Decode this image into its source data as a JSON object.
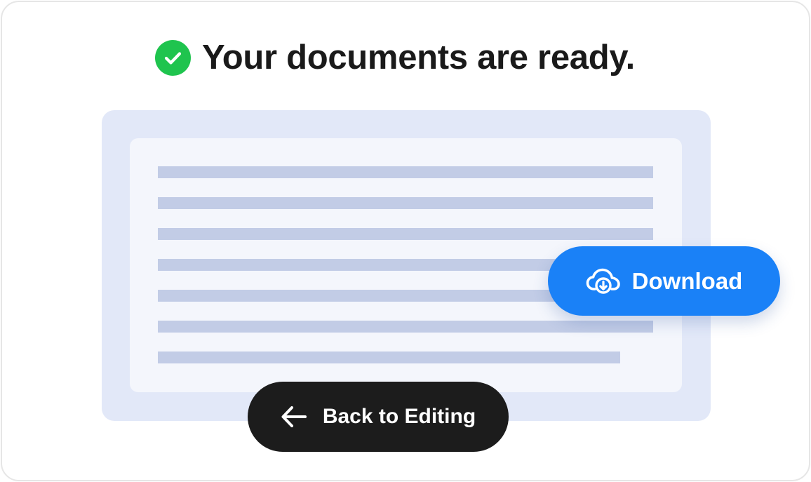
{
  "heading": {
    "icon": "check-circle-icon",
    "text": "Your documents are ready."
  },
  "document_preview": {
    "line_count": 7
  },
  "actions": {
    "download": {
      "icon": "cloud-download-icon",
      "label": "Download"
    },
    "back": {
      "icon": "arrow-left-icon",
      "label": "Back to Editing"
    }
  },
  "colors": {
    "success": "#1fc44e",
    "primary": "#1a81f7",
    "dark": "#1c1c1c",
    "preview_frame": "#e2e8f8",
    "preview_page": "#f4f6fc",
    "preview_line": "#c2cce6"
  }
}
